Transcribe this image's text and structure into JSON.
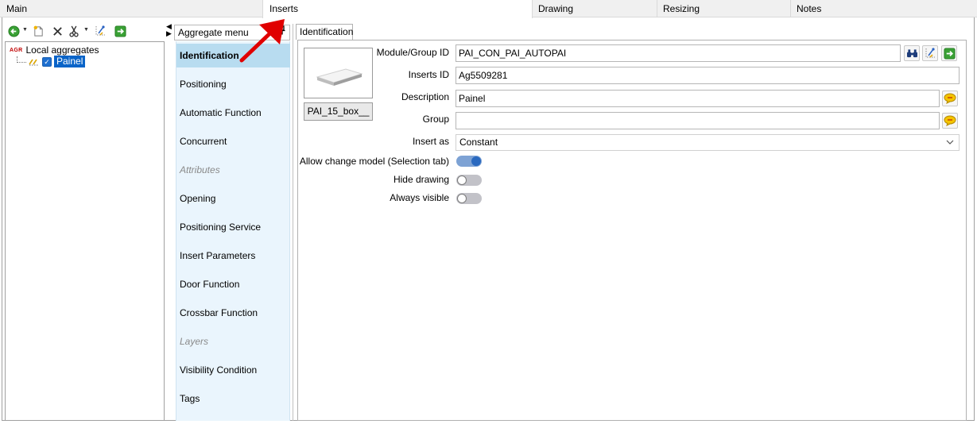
{
  "top_tabs": [
    {
      "label": "Main",
      "active": false
    },
    {
      "label": "Inserts",
      "active": true
    },
    {
      "label": "Drawing",
      "active": false
    },
    {
      "label": "Resizing",
      "active": false
    },
    {
      "label": "Notes",
      "active": false
    }
  ],
  "toolbar": {
    "icons": [
      "back-arrow-icon",
      "new-document-icon",
      "delete-icon",
      "cut-icon",
      "tree-link-icon",
      "export-icon"
    ]
  },
  "tree": {
    "root_badge": "AGR",
    "root_label": "Local aggregates",
    "child_label": "Painel",
    "child_checked": true
  },
  "aggregate_menu": {
    "title": "Aggregate menu",
    "pin": "ᵖ",
    "items": [
      {
        "label": "Identification",
        "state": "active"
      },
      {
        "label": "Positioning",
        "state": "normal"
      },
      {
        "label": "Automatic Function",
        "state": "normal"
      },
      {
        "label": "Concurrent",
        "state": "normal"
      },
      {
        "label": "Attributes",
        "state": "disabled"
      },
      {
        "label": "Opening",
        "state": "normal"
      },
      {
        "label": "Positioning Service",
        "state": "normal"
      },
      {
        "label": "Insert Parameters",
        "state": "normal"
      },
      {
        "label": "Door Function",
        "state": "normal"
      },
      {
        "label": "Crossbar Function",
        "state": "normal"
      },
      {
        "label": "Layers",
        "state": "disabled"
      },
      {
        "label": "Visibility Condition",
        "state": "normal"
      },
      {
        "label": "Tags",
        "state": "normal"
      }
    ]
  },
  "identification": {
    "tab_label": "Identification",
    "thumbnail_button": "PAI_15_box__",
    "module_group_id_label": "Module/Group ID",
    "module_group_id_value": "PAI_CON_PAI_AUTOPAI",
    "inserts_id_label": "Inserts ID",
    "inserts_id_value": "Ag5509281",
    "description_label": "Description",
    "description_value": "Painel",
    "group_label": "Group",
    "group_value": "",
    "insert_as_label": "Insert as",
    "insert_as_value": "Constant",
    "allow_change_label": "Allow change model (Selection tab)",
    "allow_change_on": true,
    "hide_drawing_label": "Hide drawing",
    "hide_drawing_on": false,
    "always_visible_label": "Always visible",
    "always_visible_on": false
  },
  "colors": {
    "selection_blue": "#0a64c8",
    "menu_bg": "#eaf5fd",
    "menu_active": "#b8dcf0",
    "toggle_on": "#2a69bf",
    "annotation_red": "#e00000"
  }
}
